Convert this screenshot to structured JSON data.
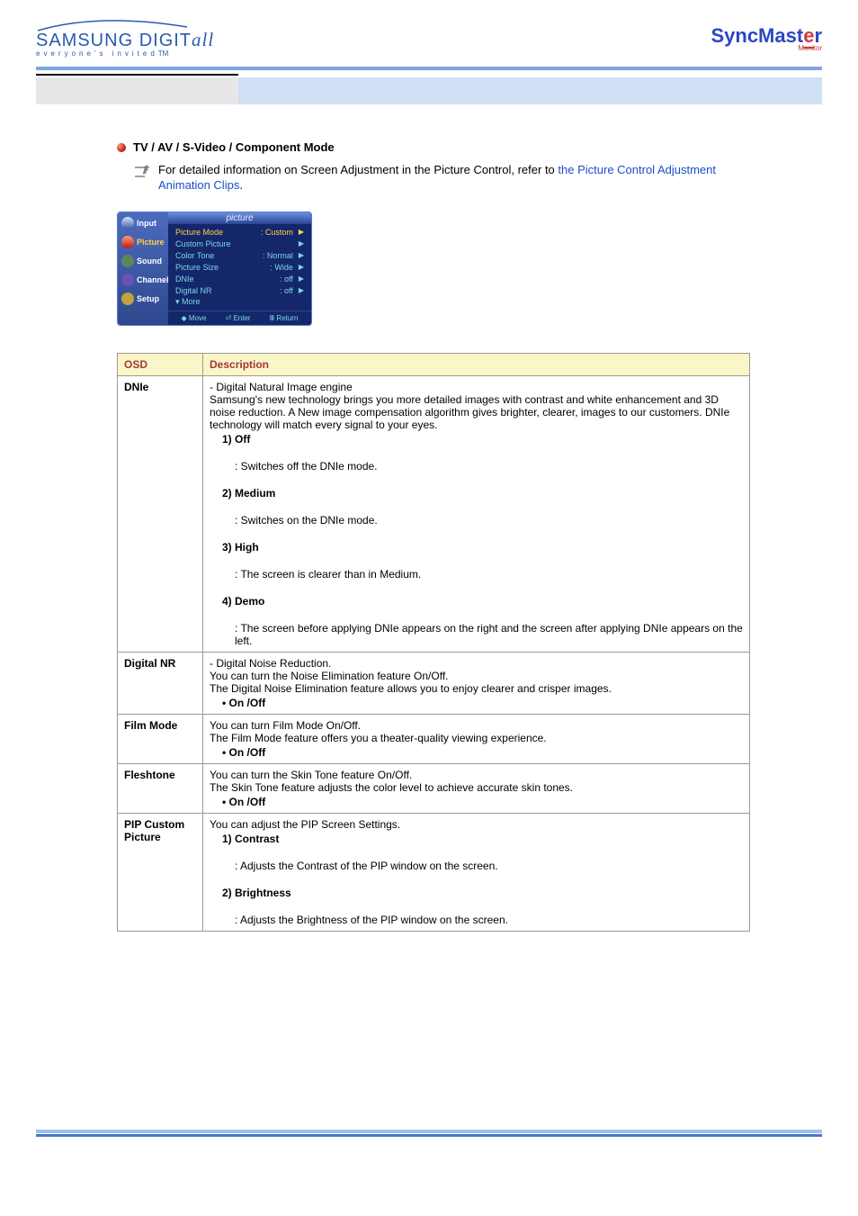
{
  "header": {
    "brand_a": "SAMSUNG ",
    "brand_b": "DIGIT",
    "brand_c": "all",
    "tagline": "everyone's invited",
    "tagline_tm": "TM",
    "right_a": "SyncMast",
    "right_b": "e",
    "right_c": "r",
    "right_sub": "Monitor"
  },
  "section": {
    "mode_title": "TV / AV / S-Video / Component Mode",
    "info_pre": "For detailed information on Screen Adjustment in the Picture Control, refer to ",
    "info_link": "the Picture Control Adjustment Animation Clips",
    "info_post": "."
  },
  "osd_menu": {
    "title": "picture",
    "side": [
      "Input",
      "Picture",
      "Sound",
      "Channel",
      "Setup"
    ],
    "items": [
      {
        "k": "Picture Mode",
        "v": ": Custom",
        "arrow": true,
        "sel": true
      },
      {
        "k": "Custom Picture",
        "v": "",
        "arrow": true
      },
      {
        "k": "Color Tone",
        "v": ": Normal",
        "arrow": true
      },
      {
        "k": "Picture Size",
        "v": ": Wide",
        "arrow": true
      },
      {
        "k": "DNIe",
        "v": ": off",
        "arrow": true
      },
      {
        "k": "Digital NR",
        "v": ": off",
        "arrow": true
      },
      {
        "k": "▾ More",
        "v": "",
        "arrow": false
      }
    ],
    "foot": [
      "◆ Move",
      "⏎ Enter",
      "Ⅲ Return"
    ]
  },
  "table": {
    "head_osd": "OSD",
    "head_desc": "Description",
    "rows": [
      {
        "osd": "DNIe",
        "desc": [
          {
            "t": "- Digital Natural Image engine"
          },
          {
            "t": "Samsung's new technology brings you more detailed images with contrast and white enhancement and 3D noise reduction. A New image compensation algorithm gives brighter, clearer, images to our customers. DNIe technology will match every signal to your eyes."
          },
          {
            "indent": 1,
            "b": true,
            "t": "1) Off"
          },
          {
            "indent": 2,
            "t": ": Switches off the DNIe mode."
          },
          {
            "indent": 1,
            "b": true,
            "t": "2) Medium"
          },
          {
            "indent": 2,
            "t": ": Switches on the DNIe mode."
          },
          {
            "indent": 1,
            "b": true,
            "t": "3) High"
          },
          {
            "indent": 2,
            "t": ": The screen is clearer than in Medium."
          },
          {
            "indent": 1,
            "b": true,
            "t": "4) Demo"
          },
          {
            "indent": 2,
            "t": ": The screen before applying DNIe appears on the right and the screen after applying DNIe appears on the left."
          }
        ]
      },
      {
        "osd": "Digital NR",
        "desc": [
          {
            "t": "- Digital Noise Reduction."
          },
          {
            "t": "You can turn the Noise Elimination feature On/Off."
          },
          {
            "t": "The Digital Noise Elimination feature allows you to enjoy clearer and crisper images."
          },
          {
            "indent": 1,
            "b": true,
            "t": "• On /Off"
          }
        ]
      },
      {
        "osd": "Film Mode",
        "desc": [
          {
            "t": "You can turn Film Mode On/Off."
          },
          {
            "t": "The Film Mode feature offers you a theater-quality viewing experience."
          },
          {
            "indent": 1,
            "b": true,
            "t": "• On /Off"
          }
        ]
      },
      {
        "osd": "Fleshtone",
        "desc": [
          {
            "t": "You can turn the Skin Tone feature On/Off."
          },
          {
            "t": "The Skin Tone feature adjusts the color level to achieve accurate skin tones."
          },
          {
            "indent": 1,
            "b": true,
            "t": "• On /Off"
          }
        ]
      },
      {
        "osd": "PIP Custom Picture",
        "desc": [
          {
            "t": "You can adjust the PIP Screen Settings."
          },
          {
            "indent": 1,
            "b": true,
            "t": "1) Contrast"
          },
          {
            "indent": 2,
            "t": ": Adjusts the Contrast of the PIP window on the screen."
          },
          {
            "indent": 1,
            "b": true,
            "t": "2) Brightness"
          },
          {
            "indent": 2,
            "t": ": Adjusts the Brightness of the PIP window on the screen."
          }
        ]
      }
    ]
  }
}
